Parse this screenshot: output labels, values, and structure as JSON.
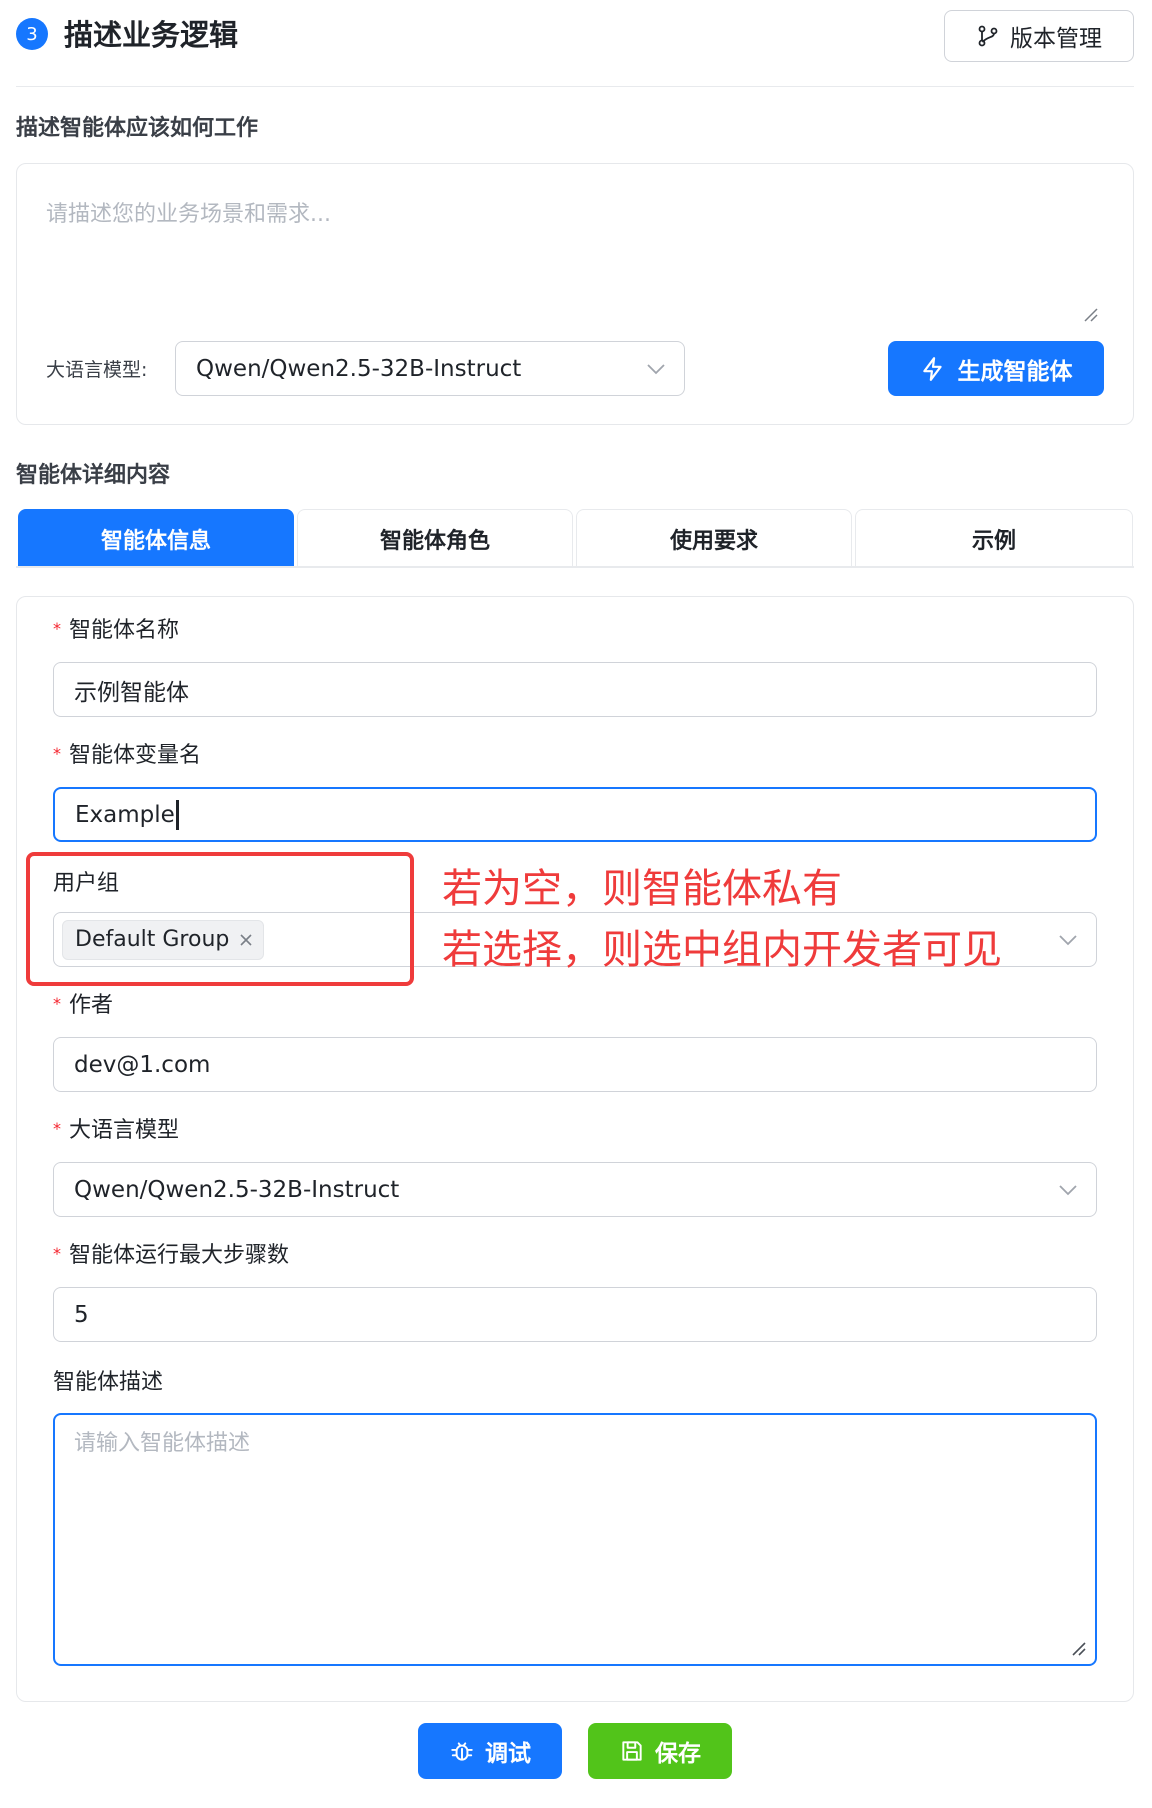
{
  "header": {
    "step_number": "3",
    "title": "描述业务逻辑",
    "version_button": "版本管理"
  },
  "describe": {
    "section_label": "描述智能体应该如何工作",
    "placeholder": "请描述您的业务场景和需求...",
    "llm_label": "大语言模型:",
    "llm_value": "Qwen/Qwen2.5-32B-Instruct",
    "generate_button": "生成智能体"
  },
  "details": {
    "section_label": "智能体详细内容",
    "tabs": [
      {
        "label": "智能体信息",
        "active": true
      },
      {
        "label": "智能体角色",
        "active": false
      },
      {
        "label": "使用要求",
        "active": false
      },
      {
        "label": "示例",
        "active": false
      }
    ]
  },
  "form": {
    "required_mark": "*",
    "name_label": "智能体名称",
    "name_value": "示例智能体",
    "var_label": "智能体变量名",
    "var_value": "Example",
    "group_label": "用户组",
    "group_tag": "Default Group",
    "author_label": "作者",
    "author_value": "dev@1.com",
    "model_label": "大语言模型",
    "model_value": "Qwen/Qwen2.5-32B-Instruct",
    "steps_label": "智能体运行最大步骤数",
    "steps_value": "5",
    "desc_label": "智能体描述",
    "desc_placeholder": "请输入智能体描述"
  },
  "annotation": {
    "line1": "若为空，则智能体私有",
    "line2": "若选择，则选中组内开发者可见",
    "color": "#ef3b3b"
  },
  "actions": {
    "debug_button": "调试",
    "save_button": "保存"
  },
  "colors": {
    "primary": "#1677ff",
    "success": "#52c41a",
    "required": "#f5222d"
  }
}
